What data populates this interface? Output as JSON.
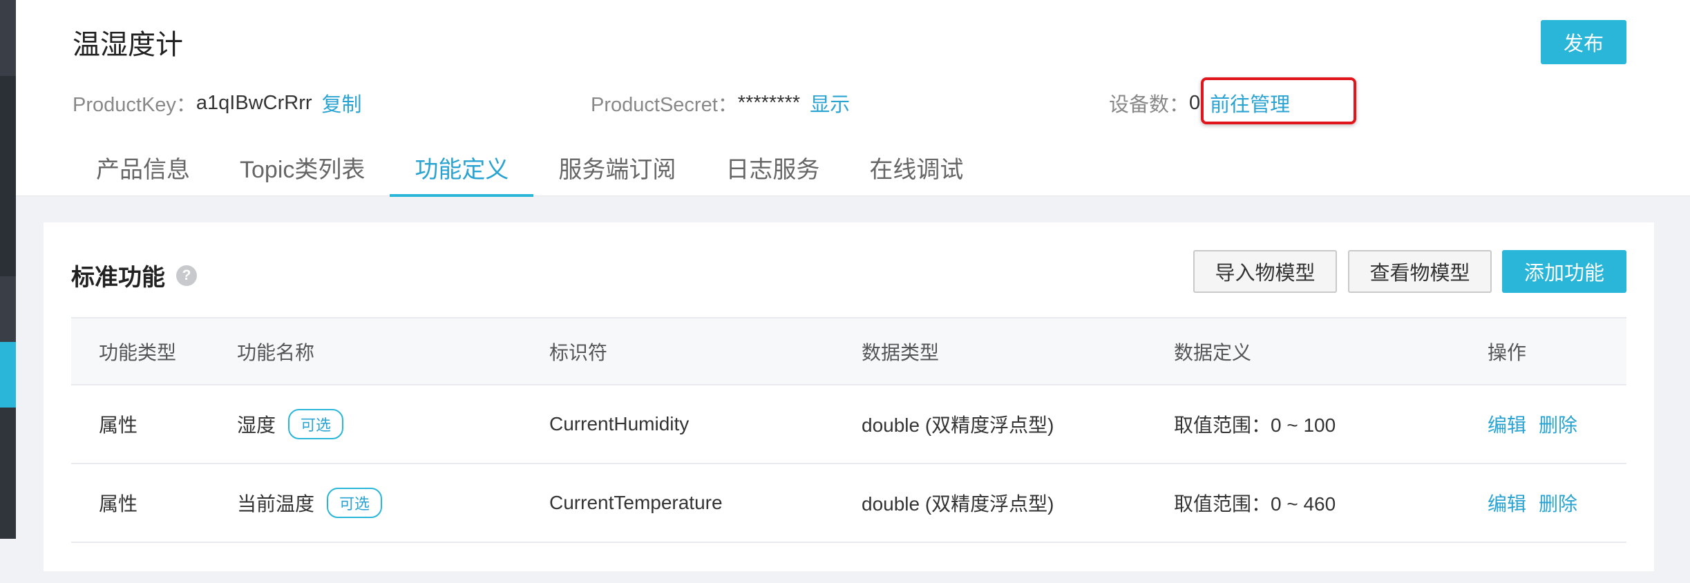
{
  "product": {
    "title": "温湿度计",
    "publish_label": "发布",
    "key_label": "ProductKey：",
    "key_value": "a1qIBwCrRrr",
    "copy_label": "复制",
    "secret_label": "ProductSecret：",
    "secret_value": "********",
    "show_label": "显示",
    "device_count_label": "设备数：",
    "device_count_value": "0",
    "manage_label": "前往管理"
  },
  "tabs": [
    {
      "label": "产品信息"
    },
    {
      "label": "Topic类列表"
    },
    {
      "label": "功能定义",
      "active": true
    },
    {
      "label": "服务端订阅"
    },
    {
      "label": "日志服务"
    },
    {
      "label": "在线调试"
    }
  ],
  "section": {
    "title": "标准功能",
    "help_icon": "help-icon",
    "import_label": "导入物模型",
    "view_label": "查看物模型",
    "add_label": "添加功能"
  },
  "table": {
    "headers": [
      "功能类型",
      "功能名称",
      "标识符",
      "数据类型",
      "数据定义",
      "操作"
    ],
    "rows": [
      {
        "type": "属性",
        "name": "湿度",
        "tag": "可选",
        "identifier": "CurrentHumidity",
        "data_type": "double (双精度浮点型)",
        "definition": "取值范围：0 ~ 100",
        "edit": "编辑",
        "delete": "删除"
      },
      {
        "type": "属性",
        "name": "当前温度",
        "tag": "可选",
        "identifier": "CurrentTemperature",
        "data_type": "double (双精度浮点型)",
        "definition": "取值范围：0 ~ 460",
        "edit": "编辑",
        "delete": "删除"
      }
    ]
  },
  "colors": {
    "accent": "#29b6d8",
    "link": "#29a3d1",
    "highlight": "#e0161c"
  }
}
